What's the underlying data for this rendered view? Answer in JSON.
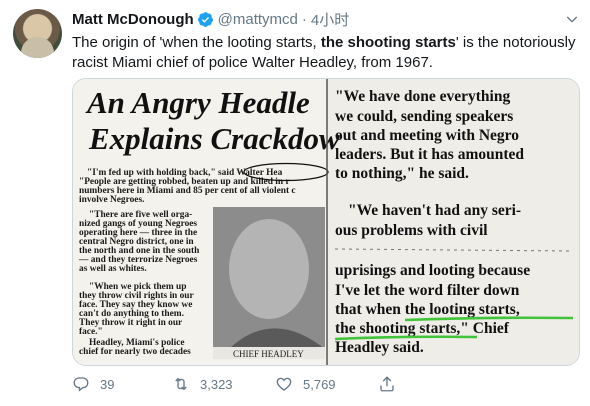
{
  "author": {
    "display_name": "Matt McDonough",
    "handle": "@mattymcd",
    "time": "4小时"
  },
  "tweet": {
    "text_before": "The origin  of 'when the looting starts, ",
    "text_bold": "the shooting starts",
    "text_after": "' is the notoriously racist Miami chief of police Walter Headley, from 1967."
  },
  "clipping": {
    "headline_line1": "An Angry Headle",
    "headline_line2": "Explains Crackdow",
    "left_column": [
      "\"I'm fed up with holding back,\" said Walter Hea",
      "\"People are getting robbed, beaten up and killed in r",
      "numbers here in Miami and 85 per cent of all violent c",
      "involve Negroes."
    ],
    "left_column2": [
      "\"There are five well orga-",
      "nized gangs of young Negroes",
      "operating here — three in the",
      "central Negro district, one in",
      "the north and one in the south",
      "— and they terrorize Negroes",
      "as well as whites.",
      "",
      "\"When we pick them up",
      "they throw civil rights in our",
      "face. They say they know we",
      "can't do anything to them.",
      "They throw it right in our",
      "face.\"",
      "Headley, Miami's police",
      "chief for nearly two decades"
    ],
    "photo_caption": "CHIEF HEADLEY",
    "right_column": [
      "\"We have done everything",
      "we could, sending speakers",
      "out and meeting with Negro",
      "leaders. But it has amounted",
      "to nothing,\" he said.",
      "",
      "\"We haven't had any seri-",
      "ous   problems   with   civil",
      "",
      "uprisings and looting because",
      "I've let the word filter down",
      "that when the looting starts,",
      "the shooting starts,\" Chief",
      "Headley said."
    ]
  },
  "actions": {
    "reply_count": "39",
    "retweet_count": "3,323",
    "like_count": "5,769"
  },
  "colors": {
    "secondary_text": "#657786",
    "verified": "#1da1f2",
    "highlight_underline": "#41c33a",
    "circle_annotation": "#111111"
  }
}
